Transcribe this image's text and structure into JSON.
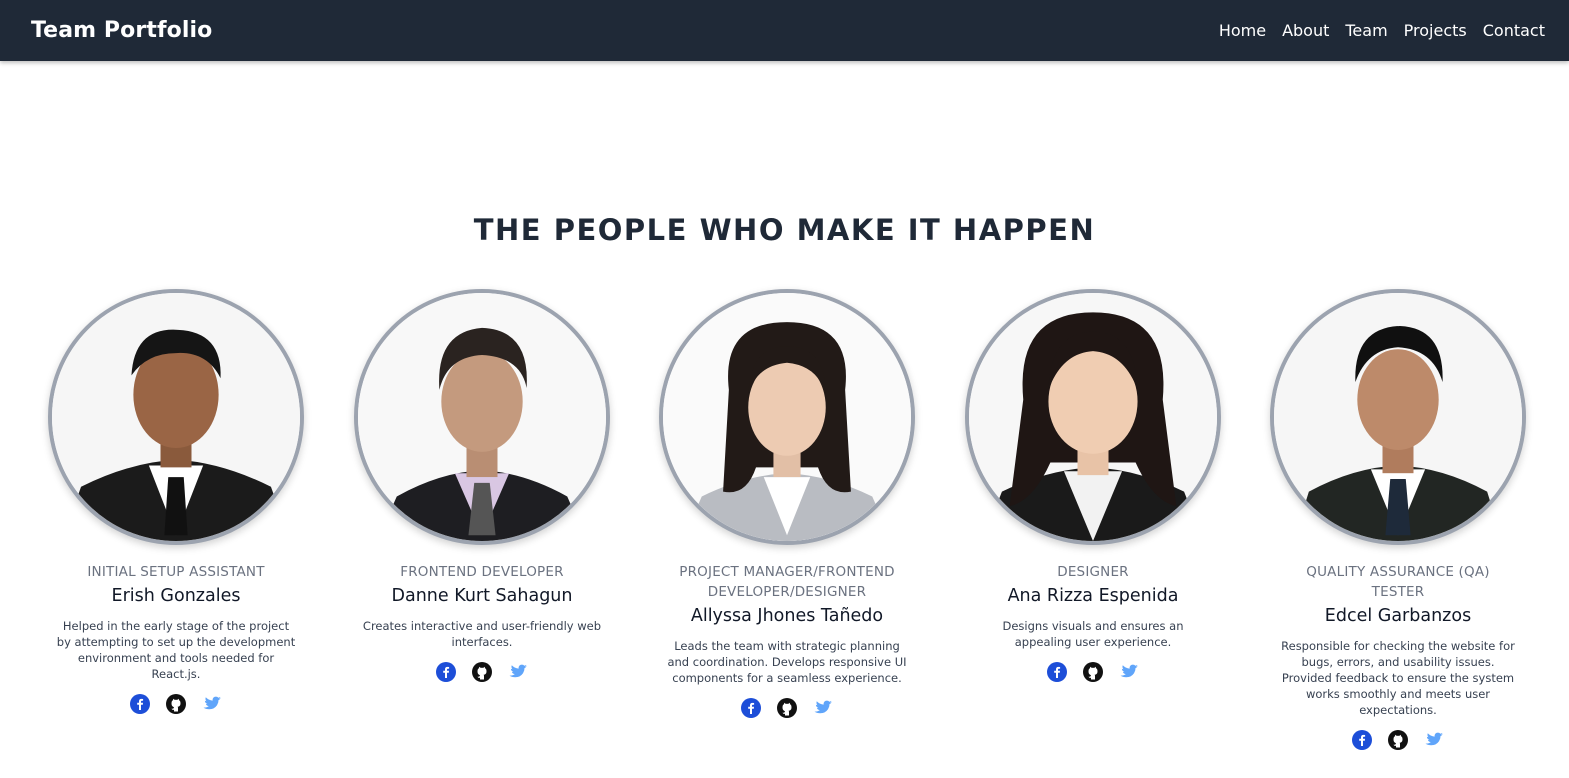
{
  "nav": {
    "brand": "Team Portfolio",
    "links": [
      "Home",
      "About",
      "Team",
      "Projects",
      "Contact"
    ]
  },
  "section": {
    "title": "THE PEOPLE WHO MAKE IT HAPPEN"
  },
  "members": [
    {
      "role": "Initial Setup Assistant",
      "name": "Erish Gonzales",
      "description": "Helped in the early stage of the project by attempting to set up the development environment and tools needed for React.js."
    },
    {
      "role": "Frontend Developer",
      "name": "Danne Kurt Sahagun",
      "description": "Creates interactive and user-friendly web interfaces."
    },
    {
      "role": "Project Manager/Frontend Developer/Designer",
      "name": "Allyssa Jhones Tañedo",
      "description": "Leads the team with strategic planning and coordination. Develops responsive UI components for a seamless experience."
    },
    {
      "role": "Designer",
      "name": "Ana Rizza Espenida",
      "description": "Designs visuals and ensures an appealing user experience."
    },
    {
      "role": "Quality Assurance (QA) Tester",
      "name": "Edcel Garbanzos",
      "description": "Responsible for checking the website for bugs, errors, and usability issues. Provided feedback to ensure the system works smoothly and meets user expectations."
    }
  ],
  "social_icons": [
    "facebook-icon",
    "github-icon",
    "twitter-icon"
  ],
  "colors": {
    "navbar": "#1f2937",
    "facebook": "#1d4ed8",
    "github": "#111111",
    "twitter": "#60a5fa",
    "avatar_border": "#9ca3af"
  }
}
